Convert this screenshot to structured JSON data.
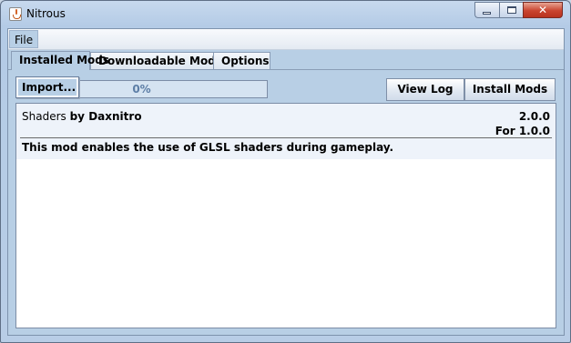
{
  "window": {
    "title": "Nitrous",
    "close_glyph": "✕"
  },
  "menubar": {
    "file": "File"
  },
  "file_menu": {
    "items": [
      {
        "label": "Import..."
      }
    ]
  },
  "tabs": [
    {
      "label": "Installed Mods",
      "active": true
    },
    {
      "label": "Downloadable Mods",
      "active": false
    },
    {
      "label": "Options",
      "active": false
    }
  ],
  "progress": {
    "text": "0%",
    "value": 0
  },
  "buttons": {
    "view_log": "View Log",
    "install_mods": "Install Mods"
  },
  "mods": [
    {
      "name": "Shaders",
      "by": "by",
      "author": "Daxnitro",
      "version": "2.0.0",
      "compat": "For 1.0.0",
      "description": "This mod enables the use of GLSL shaders during gameplay."
    }
  ],
  "colors": {
    "accent": "#b8cfe5",
    "close": "#c9442f",
    "progress_text": "#5d7ea6"
  },
  "icons": {
    "app": "java-app-icon"
  }
}
